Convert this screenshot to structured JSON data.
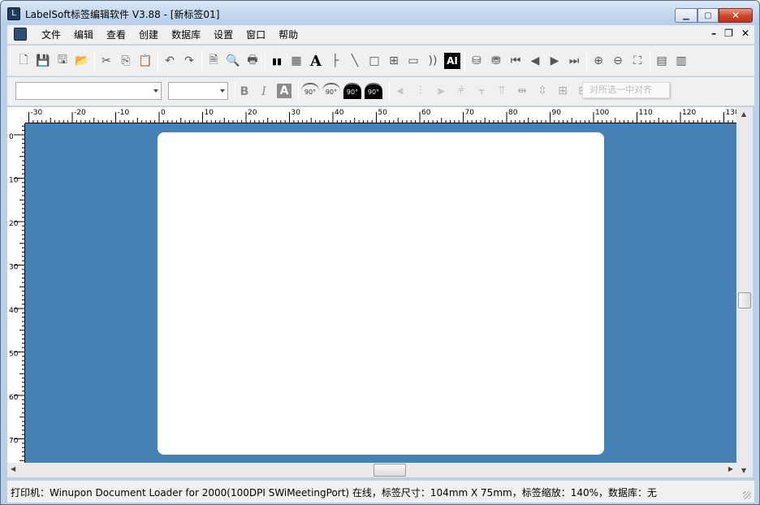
{
  "window": {
    "title": "LabelSoft标签编辑软件 V3.88 - [新标签01]"
  },
  "menu": {
    "items": [
      "文件",
      "编辑",
      "查看",
      "创建",
      "数据库",
      "设置",
      "窗口",
      "帮助"
    ]
  },
  "toolbar": {
    "icons": [
      "new-file-icon",
      "save-icon",
      "save-as-icon",
      "open-folder-icon",
      "cut-icon",
      "copy-icon",
      "paste-icon",
      "undo-icon",
      "redo-icon",
      "page-setup-icon",
      "print-preview-icon",
      "print-icon",
      "barcode-icon",
      "qrcode-icon",
      "text-icon",
      "vertical-line-icon",
      "diagonal-line-icon",
      "rectangle-icon",
      "table-icon",
      "image-icon",
      "rfid-icon",
      "ai-icon",
      "database-icon",
      "database-link-icon",
      "first-record-icon",
      "prev-record-icon",
      "next-record-icon",
      "last-record-icon",
      "zoom-in-icon",
      "zoom-out-icon",
      "zoom-fit-icon",
      "layout-horizontal-icon",
      "layout-vertical-icon"
    ],
    "ai_label": "AI",
    "rfid_label": "RFID",
    "text_glyph": "A"
  },
  "format_toolbar": {
    "font_value": "",
    "size_value": "",
    "bold": "B",
    "italic": "I",
    "text_color": "A",
    "rotate_labels": [
      "90°",
      "90°",
      "90°",
      "90°"
    ],
    "hint_text": "对所选一中对齐"
  },
  "ruler": {
    "h_labels": [
      "-30",
      "-20",
      "-10",
      "0",
      "10",
      "20",
      "30",
      "40",
      "50",
      "60",
      "70",
      "80",
      "90",
      "100",
      "110",
      "120",
      "130"
    ],
    "v_labels": [
      "0",
      "10",
      "20",
      "30",
      "40",
      "50",
      "60",
      "70"
    ]
  },
  "status": {
    "text": "打印机：Winupon Document Loader for 2000(100DPI SWiMeetingPort) 在线，标签尺寸：104mm X 75mm，标签缩放：140%，数据库：无"
  },
  "colors": {
    "canvas": "#4682b4",
    "label": "#ffffff"
  }
}
